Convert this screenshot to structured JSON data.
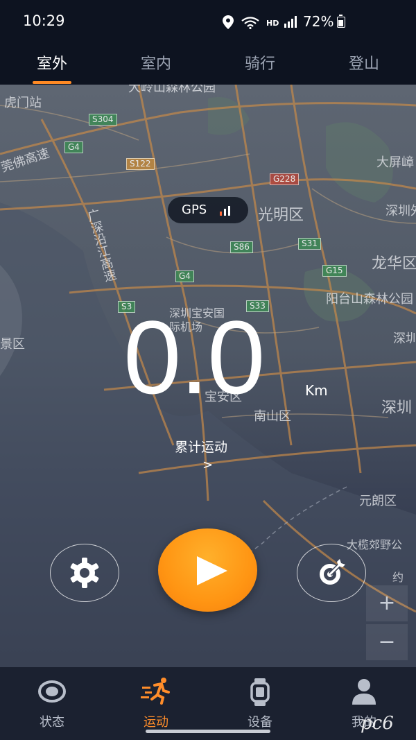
{
  "status_bar": {
    "time": "10:29",
    "network": "HD",
    "battery": "72%"
  },
  "tabs": [
    {
      "label": "室外",
      "active": true
    },
    {
      "label": "室内",
      "active": false
    },
    {
      "label": "骑行",
      "active": false
    },
    {
      "label": "登山",
      "active": false
    }
  ],
  "map": {
    "labels": [
      "虎门站",
      "大岭山森林公园",
      "莞佛高速",
      "大屏嶂",
      "光明区",
      "深圳外",
      "广深沿江高速",
      "龙华区",
      "阳台山森林公园",
      "深圳宝安国际机场",
      "深圳",
      "景区",
      "宝安区",
      "南山区",
      "深圳",
      "元朗区",
      "大榄郊野公",
      "约"
    ],
    "roads": [
      "S304",
      "G4",
      "S122",
      "G228",
      "S86",
      "S31",
      "G15",
      "G4",
      "S3",
      "S33"
    ],
    "zoom_in": "+",
    "zoom_out": "−"
  },
  "gps": {
    "label": "GPS",
    "signal_color": "#ff6a3a"
  },
  "distance": {
    "value": "0.0",
    "unit": "Km"
  },
  "cumulative": {
    "label": "累计运动",
    "chevron": ">"
  },
  "controls": {
    "settings_icon": "gear-icon",
    "play_icon": "play-icon",
    "target_icon": "target-icon"
  },
  "bottom_nav": [
    {
      "label": "状态",
      "icon": "status-ring-icon",
      "active": false
    },
    {
      "label": "运动",
      "icon": "running-icon",
      "active": true
    },
    {
      "label": "设备",
      "icon": "watch-icon",
      "active": false
    },
    {
      "label": "我的",
      "icon": "profile-icon",
      "active": false
    }
  ],
  "watermark": "pc6",
  "colors": {
    "accent": "#ff8d2a",
    "background": "#0d1320"
  }
}
